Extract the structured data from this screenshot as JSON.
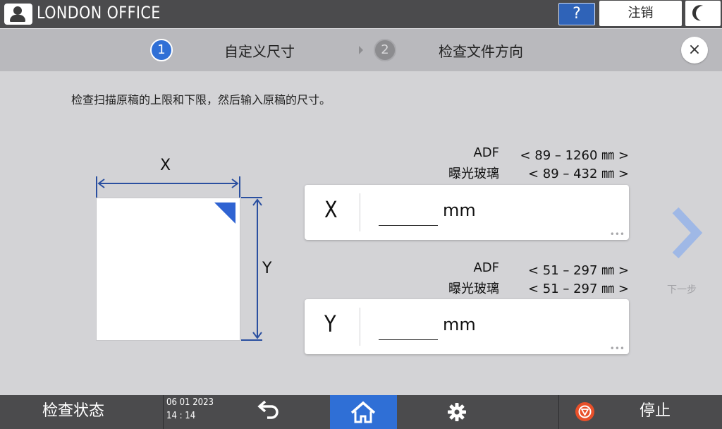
{
  "header": {
    "office_name": "LONDON OFFICE",
    "help_label": "?",
    "logout_label": "注销"
  },
  "steps": {
    "step1_number": "1",
    "step1_label": "自定义尺寸",
    "step2_number": "2",
    "step2_label": "检查文件方向",
    "close_label": "×"
  },
  "instruction": "检查扫描原稿的上限和下限，然后输入原稿的尺寸。",
  "diagram": {
    "x_label": "X",
    "y_label": "Y"
  },
  "ranges": {
    "x": [
      {
        "name": "ADF",
        "value": "< 89 – 1260 ㎜ >"
      },
      {
        "name": "曝光玻璃",
        "value": "< 89 – 432 ㎜ >"
      }
    ],
    "y": [
      {
        "name": "ADF",
        "value": "< 51 – 297 ㎜ >"
      },
      {
        "name": "曝光玻璃",
        "value": "< 51 – 297 ㎜ >"
      }
    ]
  },
  "inputs": {
    "x": {
      "axis": "X",
      "value": "",
      "unit": "mm",
      "more": "•••"
    },
    "y": {
      "axis": "Y",
      "value": "",
      "unit": "mm",
      "more": "•••"
    }
  },
  "next": {
    "label": "下一步",
    "icon": "chevron-right-icon"
  },
  "footer": {
    "status_label": "检查状态",
    "date": "06 01 2023",
    "time": "14 : 14",
    "back_icon": "back-arrow-icon",
    "home_icon": "home-icon",
    "settings_icon": "gear-icon",
    "stop_icon": "stop-icon",
    "stop_label": "停止"
  },
  "colors": {
    "accent": "#2f6fd6",
    "bar": "#4b4b4d",
    "background": "#d3d3d6",
    "stop": "#e8502a"
  }
}
